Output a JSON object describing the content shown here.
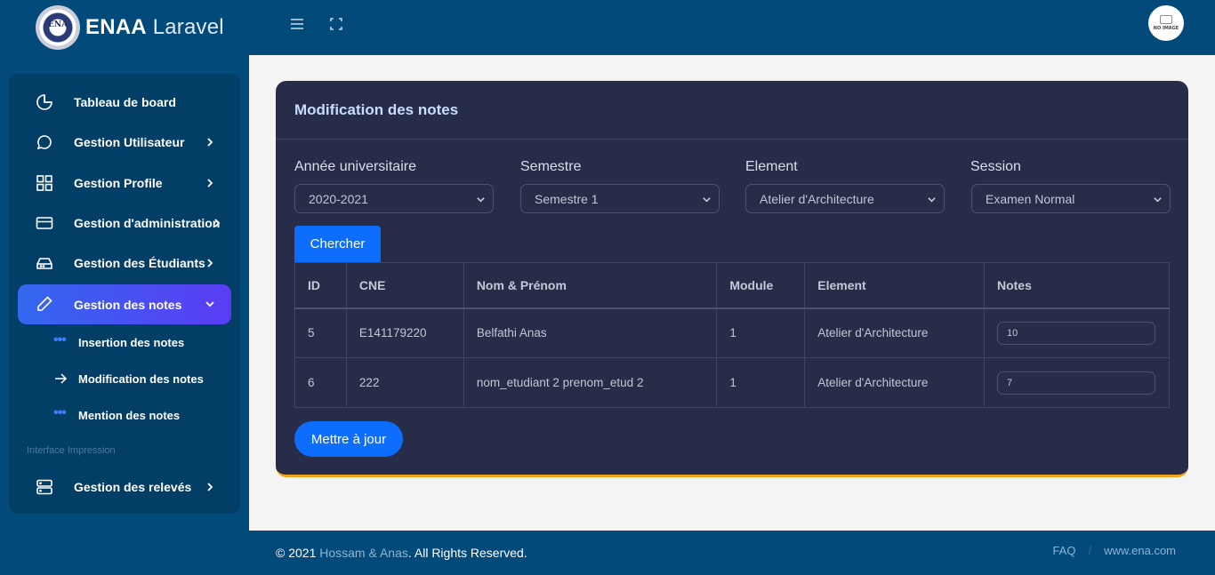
{
  "header": {
    "logo_text": "ENA",
    "brand_bold": "ENAA",
    "brand_light": "Laravel",
    "avatar_text": "NO IMAGE"
  },
  "sidebar": {
    "items": [
      {
        "label": "Tableau de board",
        "icon": "pie-chart-icon"
      },
      {
        "label": "Gestion Utilisateur",
        "icon": "chat-bubble-icon"
      },
      {
        "label": "Gestion Profile",
        "icon": "grid-icon"
      },
      {
        "label": "Gestion d'administration",
        "icon": "credit-card-icon"
      },
      {
        "label": "Gestion des Étudiants",
        "icon": "hard-drive-icon"
      },
      {
        "label": "Gestion des notes",
        "icon": "pencil-icon"
      }
    ],
    "sub_items": [
      {
        "label": "Insertion des notes",
        "icon": "dots-icon"
      },
      {
        "label": "Modification des notes",
        "icon": "arrow-right-icon"
      },
      {
        "label": "Mention des notes",
        "icon": "dots-icon"
      }
    ],
    "section_title": "Interface Impression",
    "last_item": {
      "label": "Gestion des relevés",
      "icon": "server-icon"
    }
  },
  "card": {
    "title": "Modification des notes",
    "filters": [
      {
        "label": "Année universitaire",
        "value": "2020-2021"
      },
      {
        "label": "Semestre",
        "value": "Semestre 1"
      },
      {
        "label": "Element",
        "value": "Atelier d'Architecture"
      },
      {
        "label": "Session",
        "value": "Examen Normal"
      }
    ],
    "search_button": "Chercher",
    "table": {
      "headers": [
        "ID",
        "CNE",
        "Nom & Prénom",
        "Module",
        "Element",
        "Notes"
      ],
      "rows": [
        {
          "id": "5",
          "cne": "E141179220",
          "name": "Belfathi Anas",
          "module": "1",
          "element": "Atelier d'Architecture",
          "note": "10"
        },
        {
          "id": "6",
          "cne": "222",
          "name": "nom_etudiant 2 prenom_etud 2",
          "module": "1",
          "element": "Atelier d'Architecture",
          "note": "7"
        }
      ]
    },
    "update_button": "Mettre à jour"
  },
  "footer": {
    "copyright_prefix": "© 2021 ",
    "authors": "Hossam & Anas",
    "copyright_suffix": ". All Rights Reserved.",
    "links": [
      "FAQ",
      "www.ena.com"
    ],
    "separator": "/"
  },
  "colors": {
    "header_bg": "#024a7a",
    "sidebar_bg": "#023e66",
    "card_bg": "#272d48",
    "primary": "#0d6efd",
    "accent_border": "#f0a41c"
  }
}
